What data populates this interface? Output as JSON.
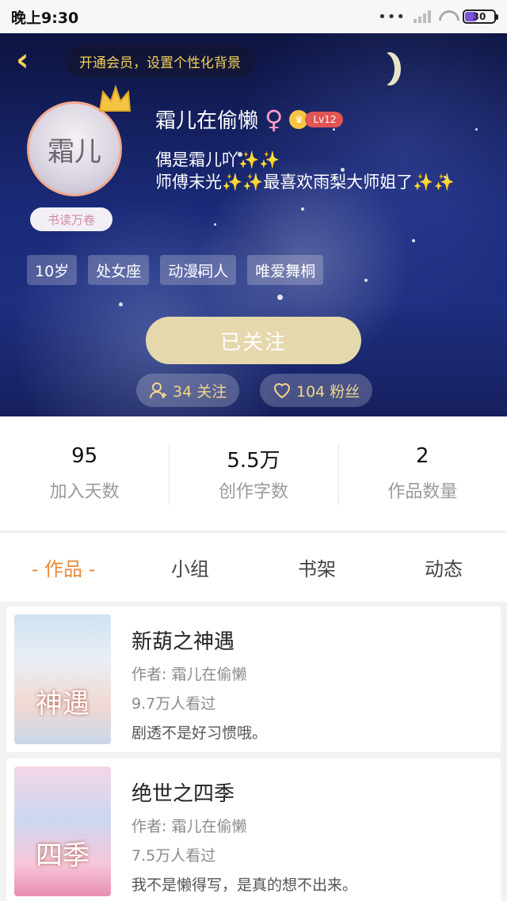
{
  "status_bar": {
    "time": "晚上9:30",
    "battery": "30"
  },
  "header": {
    "vip_prompt": "开通会员，设置个性化背景"
  },
  "profile": {
    "avatar_text": "霜儿",
    "role_badge": "书读万卷",
    "username": "霜儿在偷懒",
    "gender_symbol": "♀",
    "level": "Lv12",
    "bio_line1": "偶是霜儿吖",
    "bio_line2_a": "师傅末光",
    "bio_line2_b": "最喜欢雨梨大师姐了",
    "star_glyph": "✨",
    "tags": [
      "10岁",
      "处女座",
      "动漫同人",
      "唯爱舞桐"
    ],
    "follow_button": "已关注",
    "following": "34 关注",
    "followers": "104 粉丝"
  },
  "stats": [
    {
      "value": "95",
      "label": "加入天数"
    },
    {
      "value": "5.5万",
      "label": "创作字数"
    },
    {
      "value": "2",
      "label": "作品数量"
    }
  ],
  "tabs": [
    "- 作品 -",
    "小组",
    "书架",
    "动态"
  ],
  "works": [
    {
      "title": "新葫之神遇",
      "author": "作者: 霜儿在偷懒",
      "views": "9.7万人看过",
      "desc": "剧透不是好习惯哦。",
      "cover_text": "神遇"
    },
    {
      "title": "绝世之四季",
      "author": "作者: 霜儿在偷懒",
      "views": "7.5万人看过",
      "desc": "我不是懒得写，是真的想不出来。",
      "cover_text": "四季"
    }
  ]
}
